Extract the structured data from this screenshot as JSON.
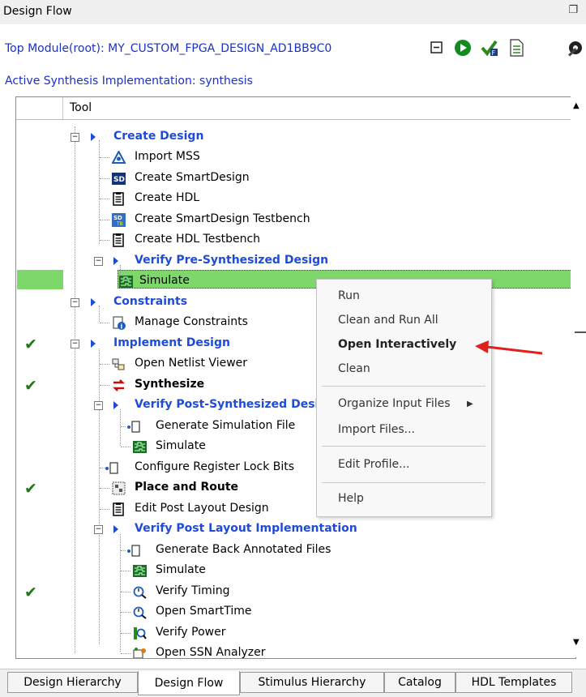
{
  "window": {
    "title": "Design Flow",
    "float_icon": "restore-icon"
  },
  "header": {
    "top_module": "Top Module(root): MY_CUSTOM_FPGA_DESIGN_AD1BB9C0",
    "active_synthesis": "Active Synthesis Implementation: synthesis"
  },
  "toolbar": {
    "icons": [
      "collapse-all-icon",
      "run-icon",
      "check-icon",
      "report-icon",
      "settings-icon"
    ]
  },
  "grid": {
    "column_header": "Tool"
  },
  "tree": {
    "items": [
      {
        "label": "Create Design",
        "icon": "expand-triangle",
        "header": true
      },
      {
        "label": "Import MSS",
        "icon": "import-mss-icon"
      },
      {
        "label": "Create SmartDesign",
        "icon": "smartdesign-icon"
      },
      {
        "label": "Create HDL",
        "icon": "document-icon"
      },
      {
        "label": "Create SmartDesign Testbench",
        "icon": "smartdesign-testbench-icon"
      },
      {
        "label": "Create HDL Testbench",
        "icon": "document-icon"
      },
      {
        "label": "Verify Pre-Synthesized Design",
        "icon": "expand-triangle",
        "header": true
      },
      {
        "label": "Simulate",
        "icon": "simulate-icon",
        "selected": true
      },
      {
        "label": "Constraints",
        "icon": "expand-triangle",
        "header": true
      },
      {
        "label": "Manage Constraints",
        "icon": "constraints-icon"
      },
      {
        "label": "Implement Design",
        "icon": "expand-triangle",
        "header": true,
        "status": "✔"
      },
      {
        "label": "Open Netlist Viewer",
        "icon": "netlist-icon"
      },
      {
        "label": "Synthesize",
        "icon": "synthesize-icon",
        "bold": true,
        "status": "✔"
      },
      {
        "label": "Verify Post-Synthesized Design",
        "icon": "expand-triangle",
        "header": true
      },
      {
        "label": "Generate Simulation File",
        "icon": "generate-icon"
      },
      {
        "label": "Simulate",
        "icon": "simulate-icon"
      },
      {
        "label": "Configure Register Lock Bits",
        "icon": "generate-icon"
      },
      {
        "label": "Place and Route",
        "icon": "place-route-icon",
        "bold": true,
        "status": "✔"
      },
      {
        "label": "Edit Post Layout Design",
        "icon": "document-icon"
      },
      {
        "label": "Verify Post Layout Implementation",
        "icon": "expand-triangle",
        "header": true
      },
      {
        "label": "Generate Back Annotated Files",
        "icon": "generate-icon"
      },
      {
        "label": "Simulate",
        "icon": "simulate-icon"
      },
      {
        "label": "Verify Timing",
        "icon": "timing-icon",
        "status": "✔"
      },
      {
        "label": "Open SmartTime",
        "icon": "timing-icon"
      },
      {
        "label": "Verify Power",
        "icon": "power-icon"
      },
      {
        "label": "Open SSN Analyzer",
        "icon": "ssn-icon"
      }
    ]
  },
  "context_menu": {
    "items": [
      "Run",
      "Clean and Run All",
      "Open Interactively",
      "Clean",
      "Organize Input Files",
      "Import Files...",
      "Edit Profile...",
      "Help"
    ]
  },
  "bottom_tabs": [
    "Design Hierarchy",
    "Design Flow",
    "Stimulus Hierarchy",
    "Catalog",
    "HDL Templates"
  ],
  "colors": {
    "accent_blue": "#1e4bd8",
    "selection_green": "#7ed76a",
    "check_green": "#1e7a14",
    "arrow_red": "#e0201a"
  }
}
